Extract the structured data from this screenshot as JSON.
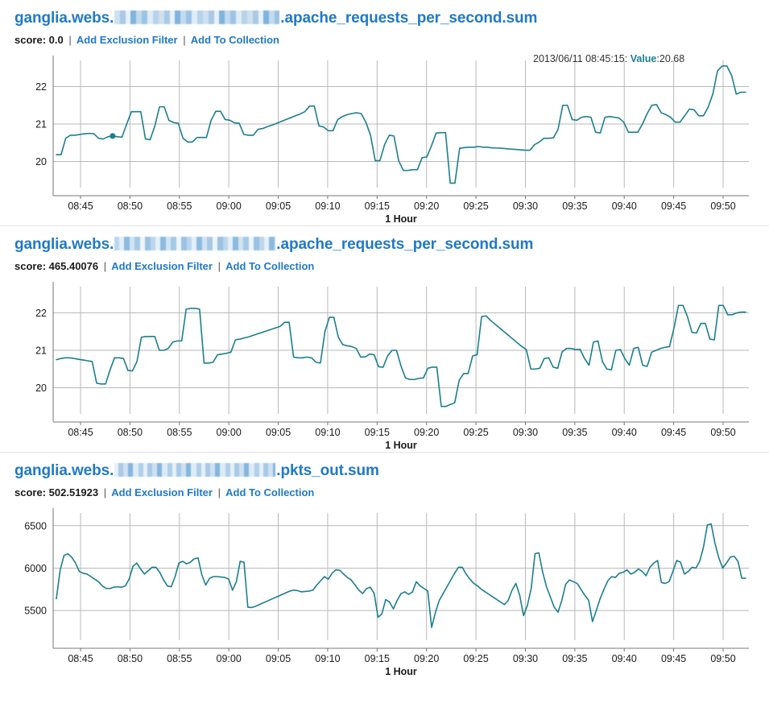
{
  "panels": [
    {
      "title_prefix": "ganglia.webs.",
      "title_redacted": "[redacted]",
      "title_suffix": ".apache_requests_per_second.sum",
      "score_label": "score:",
      "score_value": "0.0",
      "separator": "|",
      "links": [
        "Add Exclusion Filter",
        "Add To Collection"
      ],
      "tooltip": {
        "timestamp": "2013/06/11 08:45:15:",
        "value_label": "Value",
        "value_sep": ":",
        "value": "20.68",
        "visible": true
      },
      "chart_data": {
        "type": "line",
        "title": "ganglia.webs.[redacted].apache_requests_per_second.sum",
        "xlabel": "1 Hour",
        "ylabel": "",
        "grid": true,
        "legend": "none",
        "ylim": [
          19.3,
          22.7
        ],
        "yticks": [
          20,
          21,
          22
        ],
        "xticks": [
          "08:45",
          "08:50",
          "08:55",
          "09:00",
          "09:05",
          "09:10",
          "09:15",
          "09:20",
          "09:25",
          "09:30",
          "09:35",
          "09:40",
          "09:45",
          "09:50"
        ],
        "xlim": [
          "08:43",
          "09:51"
        ],
        "highlight_point": {
          "x": "08:45:15",
          "y": 20.68
        },
        "series": [
          {
            "name": "apache_requests_per_second.sum",
            "color": "#1b7f8c",
            "values": [
              20.18,
              20.18,
              20.62,
              20.7,
              20.7,
              20.72,
              20.74,
              20.75,
              20.74,
              20.62,
              20.6,
              20.66,
              20.68,
              20.66,
              20.65,
              21.0,
              21.33,
              21.33,
              21.33,
              20.6,
              20.58,
              20.95,
              21.46,
              21.46,
              21.1,
              21.04,
              21.02,
              20.62,
              20.52,
              20.52,
              20.64,
              20.64,
              20.64,
              21.1,
              21.34,
              21.34,
              21.12,
              21.1,
              21.03,
              21.02,
              20.72,
              20.7,
              20.7,
              20.86,
              20.88,
              20.93,
              20.97,
              21.02,
              21.07,
              21.12,
              21.17,
              21.22,
              21.27,
              21.33,
              21.48,
              21.48,
              20.95,
              20.92,
              20.82,
              20.82,
              21.12,
              21.2,
              21.25,
              21.28,
              21.3,
              21.28,
              21.05,
              20.7,
              20.02,
              20.02,
              20.45,
              20.7,
              20.68,
              20.02,
              19.76,
              19.76,
              19.78,
              19.78,
              20.1,
              20.12,
              20.42,
              20.76,
              20.77,
              20.77,
              19.42,
              19.42,
              20.35,
              20.37,
              20.38,
              20.38,
              20.4,
              20.38,
              20.38,
              20.36,
              20.36,
              20.35,
              20.34,
              20.33,
              20.32,
              20.31,
              20.3,
              20.3,
              20.45,
              20.52,
              20.62,
              20.62,
              20.63,
              20.86,
              21.5,
              21.5,
              21.12,
              21.1,
              21.18,
              21.2,
              21.18,
              20.78,
              20.76,
              21.18,
              21.2,
              21.18,
              21.16,
              21.05,
              20.78,
              20.78,
              20.78,
              21.0,
              21.28,
              21.5,
              21.52,
              21.3,
              21.25,
              21.18,
              21.05,
              21.05,
              21.22,
              21.4,
              21.38,
              21.22,
              21.22,
              21.45,
              21.8,
              22.42,
              22.55,
              22.55,
              22.3,
              21.8,
              21.85,
              21.85
            ]
          }
        ]
      }
    },
    {
      "title_prefix": "ganglia.webs.",
      "title_redacted": "[redacted]",
      "title_suffix": ".apache_requests_per_second.sum",
      "score_label": "score:",
      "score_value": "465.40076",
      "separator": "|",
      "links": [
        "Add Exclusion Filter",
        "Add To Collection"
      ],
      "tooltip": {
        "timestamp": "",
        "value_label": "",
        "value_sep": "",
        "value": "",
        "visible": false
      },
      "chart_data": {
        "type": "line",
        "title": "ganglia.webs.[redacted].apache_requests_per_second.sum",
        "xlabel": "1 Hour",
        "ylabel": "",
        "grid": true,
        "legend": "none",
        "ylim": [
          19.3,
          22.7
        ],
        "yticks": [
          20,
          21,
          22
        ],
        "xticks": [
          "08:45",
          "08:50",
          "08:55",
          "09:00",
          "09:05",
          "09:10",
          "09:15",
          "09:20",
          "09:25",
          "09:30",
          "09:35",
          "09:40",
          "09:45",
          "09:50"
        ],
        "xlim": [
          "08:43",
          "09:51"
        ],
        "series": [
          {
            "name": "apache_requests_per_second.sum",
            "color": "#1b7f8c",
            "values": [
              20.75,
              20.78,
              20.8,
              20.8,
              20.78,
              20.76,
              20.74,
              20.72,
              20.7,
              20.12,
              20.1,
              20.1,
              20.48,
              20.8,
              20.8,
              20.78,
              20.46,
              20.45,
              20.7,
              21.35,
              21.37,
              21.37,
              21.37,
              21.0,
              21.0,
              21.05,
              21.22,
              21.25,
              21.25,
              22.1,
              22.12,
              22.12,
              22.1,
              20.66,
              20.66,
              20.68,
              20.88,
              20.9,
              20.92,
              20.95,
              21.28,
              21.3,
              21.33,
              21.36,
              21.4,
              21.44,
              21.48,
              21.52,
              21.56,
              21.6,
              21.64,
              21.75,
              21.75,
              20.82,
              20.8,
              20.8,
              20.82,
              20.8,
              20.68,
              20.66,
              21.5,
              21.88,
              21.88,
              21.35,
              21.15,
              21.12,
              21.1,
              21.05,
              20.82,
              20.82,
              20.9,
              20.88,
              20.56,
              20.55,
              20.85,
              21.0,
              21.0,
              20.58,
              20.26,
              20.22,
              20.22,
              20.25,
              20.26,
              20.52,
              20.55,
              20.55,
              19.5,
              19.5,
              19.55,
              19.6,
              20.2,
              20.38,
              20.38,
              20.85,
              20.88,
              21.9,
              21.92,
              21.8,
              21.7,
              21.6,
              21.5,
              21.4,
              21.3,
              21.2,
              21.1,
              21.02,
              20.5,
              20.5,
              20.52,
              20.78,
              20.8,
              20.55,
              20.52,
              20.96,
              21.05,
              21.05,
              21.02,
              21.03,
              20.78,
              20.6,
              21.22,
              21.25,
              20.7,
              20.5,
              20.48,
              21.0,
              21.02,
              20.78,
              20.6,
              21.05,
              21.08,
              20.6,
              20.57,
              20.95,
              21.0,
              21.05,
              21.08,
              21.1,
              21.6,
              22.2,
              22.2,
              21.9,
              21.48,
              21.46,
              21.72,
              21.72,
              21.3,
              21.28,
              22.2,
              22.2,
              21.95,
              21.95,
              22.0,
              22.02,
              22.02
            ]
          }
        ]
      }
    },
    {
      "title_prefix": "ganglia.webs.",
      "title_redacted": "[redacted]",
      "title_suffix": ".pkts_out.sum",
      "score_label": "score:",
      "score_value": "502.51923",
      "separator": "|",
      "links": [
        "Add Exclusion Filter",
        "Add To Collection"
      ],
      "tooltip": {
        "timestamp": "",
        "value_label": "",
        "value_sep": "",
        "value": "",
        "visible": false
      },
      "chart_data": {
        "type": "line",
        "title": "ganglia.webs.[redacted].pkts_out.sum",
        "xlabel": "1 Hour",
        "ylabel": "",
        "grid": true,
        "legend": "none",
        "ylim": [
          5150,
          6650
        ],
        "yticks": [
          5500,
          6000,
          6500
        ],
        "xticks": [
          "08:45",
          "08:50",
          "08:55",
          "09:00",
          "09:05",
          "09:10",
          "09:15",
          "09:20",
          "09:25",
          "09:30",
          "09:35",
          "09:40",
          "09:45",
          "09:50"
        ],
        "xlim": [
          "08:43",
          "09:51"
        ],
        "series": [
          {
            "name": "pkts_out.sum",
            "color": "#1b7f8c",
            "values": [
              5640,
              5980,
              6150,
              6170,
              6130,
              6060,
              5960,
              5940,
              5930,
              5900,
              5870,
              5840,
              5790,
              5760,
              5760,
              5775,
              5780,
              5775,
              5790,
              5870,
              6020,
              6060,
              5990,
              5930,
              5970,
              6010,
              6010,
              5950,
              5860,
              5790,
              5780,
              5900,
              6060,
              6080,
              6050,
              6070,
              6110,
              6120,
              5920,
              5800,
              5880,
              5900,
              5900,
              5895,
              5890,
              5870,
              5740,
              5840,
              6080,
              6070,
              5540,
              5535,
              5550,
              5570,
              5590,
              5610,
              5630,
              5650,
              5670,
              5690,
              5710,
              5730,
              5740,
              5735,
              5720,
              5725,
              5730,
              5740,
              5800,
              5850,
              5900,
              5870,
              5940,
              5980,
              5975,
              5930,
              5890,
              5860,
              5800,
              5740,
              5700,
              5760,
              5775,
              5700,
              5420,
              5460,
              5630,
              5600,
              5520,
              5620,
              5700,
              5720,
              5690,
              5720,
              5840,
              5790,
              5760,
              5730,
              5300,
              5480,
              5620,
              5700,
              5780,
              5860,
              5940,
              6010,
              6010,
              5930,
              5870,
              5820,
              5790,
              5750,
              5720,
              5690,
              5660,
              5630,
              5600,
              5570,
              5620,
              5740,
              5820,
              5680,
              5440,
              5560,
              5760,
              6170,
              6180,
              5950,
              5780,
              5660,
              5540,
              5480,
              5620,
              5810,
              5860,
              5840,
              5820,
              5750,
              5680,
              5620,
              5370,
              5500,
              5640,
              5750,
              5850,
              5900,
              5890,
              5940,
              5950,
              5980,
              5930,
              5950,
              5990,
              5960,
              5910,
              6010,
              6060,
              6090,
              5830,
              5820,
              5840,
              5960,
              6090,
              6070,
              5930,
              5960,
              6010,
              6000,
              6080,
              6250,
              6510,
              6520,
              6290,
              6120,
              6000,
              6060,
              6130,
              6140,
              6080,
              5880,
              5880
            ]
          }
        ]
      }
    }
  ]
}
